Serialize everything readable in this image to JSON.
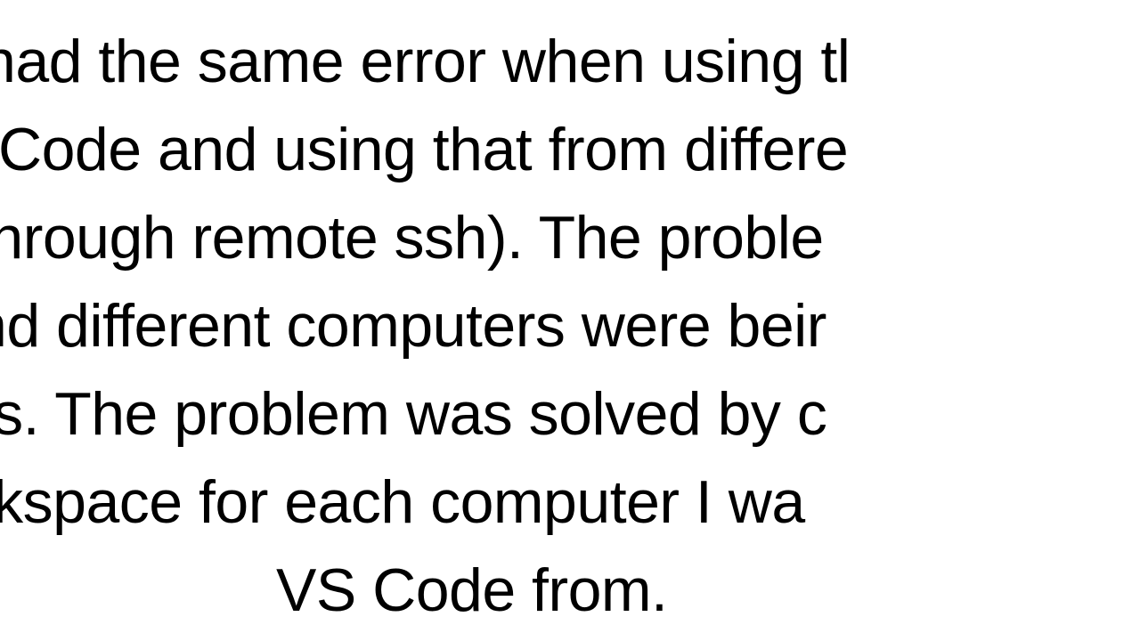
{
  "lines": {
    "l1": "nad the same error when using tl",
    "l2": "Code and using that from differe",
    "l3": "through remote ssh). The proble",
    "l4": "nd different computers were beir",
    "l5": "rs. The problem was solved by c",
    "l6": "rkspace for each computer I wa",
    "l7": "VS Code from."
  }
}
